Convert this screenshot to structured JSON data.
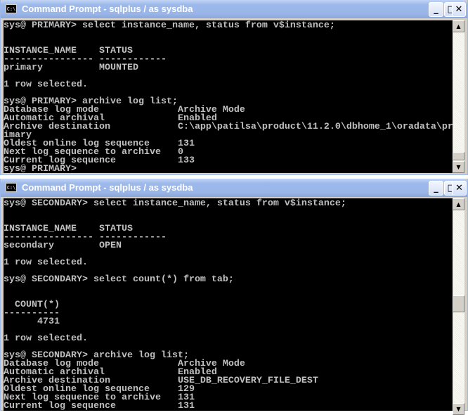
{
  "windows": [
    {
      "title": "Command Prompt - sqlplus / as sysdba",
      "icon": "cmd-icon",
      "icon_text": "C:\\",
      "controls": {
        "minimize": "_",
        "maximize": "□",
        "close": "✕"
      },
      "scroll_position": 0.9,
      "lines": [
        "sys@ PRIMARY> select instance_name, status from v$instance;",
        "",
        "",
        "INSTANCE_NAME    STATUS",
        "---------------- ------------",
        "primary          MOUNTED",
        "",
        "1 row selected.",
        "",
        "sys@ PRIMARY> archive log list;",
        "Database log mode              Archive Mode",
        "Automatic archival             Enabled",
        "Archive destination            C:\\app\\patilsa\\product\\11.2.0\\dbhome_1\\oradata\\pr",
        "imary",
        "Oldest online log sequence     131",
        "Next log sequence to archive   0",
        "Current log sequence           133",
        "sys@ PRIMARY>"
      ]
    },
    {
      "title": "Command Prompt - sqlplus / as sysdba",
      "icon": "cmd-icon",
      "icon_text": "C:\\",
      "controls": {
        "minimize": "_",
        "maximize": "□",
        "close": "✕"
      },
      "scroll_position": 0.55,
      "lines": [
        "sys@ SECONDARY> select instance_name, status from v$instance;",
        "",
        "",
        "INSTANCE_NAME    STATUS",
        "---------------- ------------",
        "secondary        OPEN",
        "",
        "1 row selected.",
        "",
        "sys@ SECONDARY> select count(*) from tab;",
        "",
        "",
        "  COUNT(*)",
        "----------",
        "      4731",
        "",
        "1 row selected.",
        "",
        "sys@ SECONDARY> archive log list;",
        "Database log mode              Archive Mode",
        "Automatic archival             Enabled",
        "Archive destination            USE_DB_RECOVERY_FILE_DEST",
        "Oldest online log sequence     129",
        "Next log sequence to archive   131",
        "Current log sequence           131"
      ]
    }
  ]
}
